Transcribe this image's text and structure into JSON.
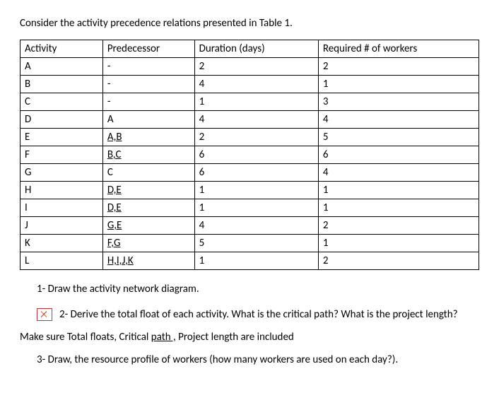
{
  "intro": "Consider the activity precedence relations presented in Table 1.",
  "table": {
    "headers": {
      "activity": "Activity",
      "predecessor": "Predecessor",
      "duration": "Duration (days)",
      "required": "Required # of workers"
    },
    "rows": [
      {
        "activity": "A",
        "predecessor": "-",
        "duration": "2",
        "required": "2",
        "pred_underlined": false
      },
      {
        "activity": "B",
        "predecessor": "-",
        "duration": "4",
        "required": "1",
        "pred_underlined": false
      },
      {
        "activity": "C",
        "predecessor": "-",
        "duration": "1",
        "required": "3",
        "pred_underlined": false
      },
      {
        "activity": "D",
        "predecessor": "A",
        "duration": "4",
        "required": "4",
        "pred_underlined": false
      },
      {
        "activity": "E",
        "predecessor": "A,B",
        "duration": "2",
        "required": "5",
        "pred_underlined": true
      },
      {
        "activity": "F",
        "predecessor": "B,C",
        "duration": "6",
        "required": "6",
        "pred_underlined": true
      },
      {
        "activity": "G",
        "predecessor": "C",
        "duration": "6",
        "required": "4",
        "pred_underlined": false
      },
      {
        "activity": "H",
        "predecessor": "D,E",
        "duration": "1",
        "required": "1",
        "pred_underlined": true
      },
      {
        "activity": "I",
        "predecessor": "D,E",
        "duration": "1",
        "required": "1",
        "pred_underlined": true
      },
      {
        "activity": "J",
        "predecessor": "G,E",
        "duration": "4",
        "required": "2",
        "pred_underlined": true
      },
      {
        "activity": "K",
        "predecessor": "F,G",
        "duration": "5",
        "required": "1",
        "pred_underlined": true
      },
      {
        "activity": "L",
        "predecessor": "H,I,J,K",
        "duration": "1",
        "required": "2",
        "pred_underlined": true
      }
    ]
  },
  "questions": {
    "q1": "1-   Draw the activity network diagram.",
    "q2": "2-   Derive the total float of each activity. What is the critical path? What is the project length?",
    "makesure_pre": "Make sure Total floats, Critical ",
    "makesure_underlined": "path ,",
    "makesure_post": " Project length are included",
    "q3": "3-   Draw, the resource profile of workers (how many workers are used on each day?)."
  }
}
